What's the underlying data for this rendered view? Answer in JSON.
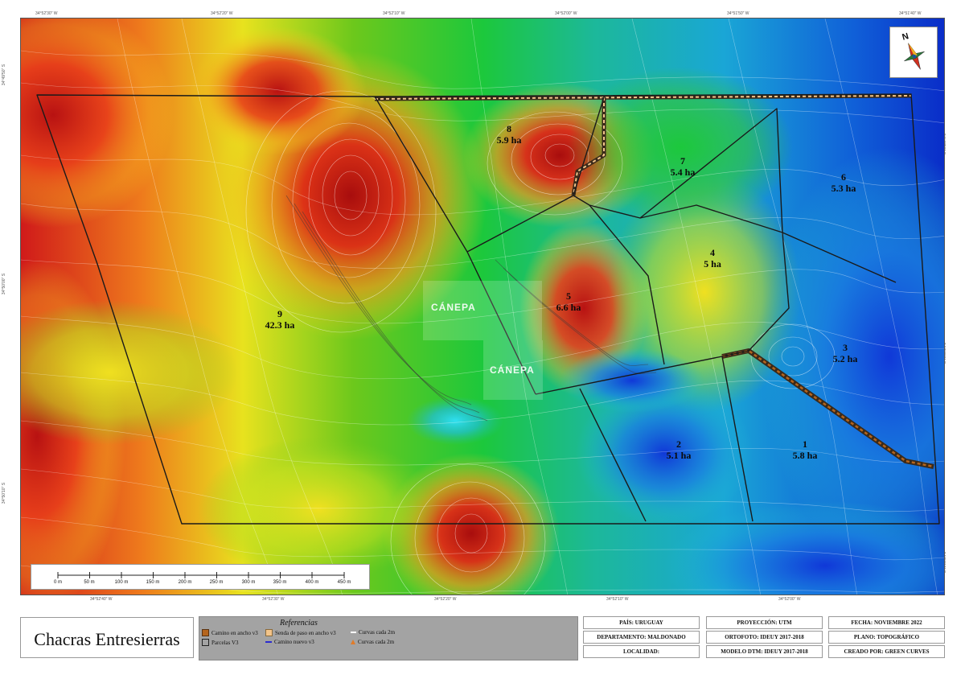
{
  "coords": {
    "top": [
      "34°52'30\" W",
      "34°52'20\" W",
      "34°52'10\" W",
      "34°52'00\" W",
      "34°51'50\" W",
      "34°51'40\" W"
    ],
    "bottom": [
      "34°52'40\" W",
      "34°52'30\" W",
      "34°52'20\" W",
      "34°52'10\" W",
      "34°52'00\" W"
    ],
    "left": [
      "34°49'50\" S",
      "34°50'00\" S",
      "34°50'10\" S"
    ],
    "right": [
      "34°49'50\" S",
      "34°50'00\" S",
      "34°50'10\" S"
    ]
  },
  "parcels": [
    {
      "id": "9",
      "area": "42.3 ha"
    },
    {
      "id": "8",
      "area": "5.9 ha"
    },
    {
      "id": "7",
      "area": "5.4 ha"
    },
    {
      "id": "6",
      "area": "5.3 ha"
    },
    {
      "id": "5",
      "area": "6.6 ha"
    },
    {
      "id": "4",
      "area": "5 ha"
    },
    {
      "id": "3",
      "area": "5.2 ha"
    },
    {
      "id": "2",
      "area": "5.1 ha"
    },
    {
      "id": "1",
      "area": "5.8 ha"
    }
  ],
  "watermark": "CÁNEPA",
  "north_label": "N",
  "scale_labels": [
    "0 m",
    "50 m",
    "100 m",
    "150 m",
    "200 m",
    "250 m",
    "300 m",
    "350 m",
    "400 m",
    "450 m"
  ],
  "title": "Chacras Entresierras",
  "legend": {
    "title": "Referencias",
    "items": [
      {
        "label": "Camino en ancho v3",
        "color": "#b5651d"
      },
      {
        "label": "Senda de paso en ancho v3",
        "color": "#f2c48a"
      },
      {
        "label": "Curvas cada 2m",
        "color": "#ffffff"
      },
      {
        "label": "Parcelas V3",
        "color": "#222222"
      },
      {
        "label": "Camino nuevo v3",
        "color": "#2b2bd0"
      },
      {
        "label": "Curvas cada 2m",
        "color": "#e07b2a"
      }
    ]
  },
  "info": {
    "pais": "PAÍS: URUGUAY",
    "departamento": "DEPARTAMENTO: MALDONADO",
    "localidad": "LOCALIDAD:",
    "proyeccion": "PROYECCIÓN: UTM",
    "ortofoto": "ORTOFOTO: IDEUY 2017-2018",
    "modelo": "MODELO DTM: IDEUY 2017-2018",
    "fecha": "FECHA: NOVIEMBRE 2022",
    "plano": "PLANO: TOPOGRÁFICO",
    "creado": "CREADO POR: GREEN CURVES"
  }
}
